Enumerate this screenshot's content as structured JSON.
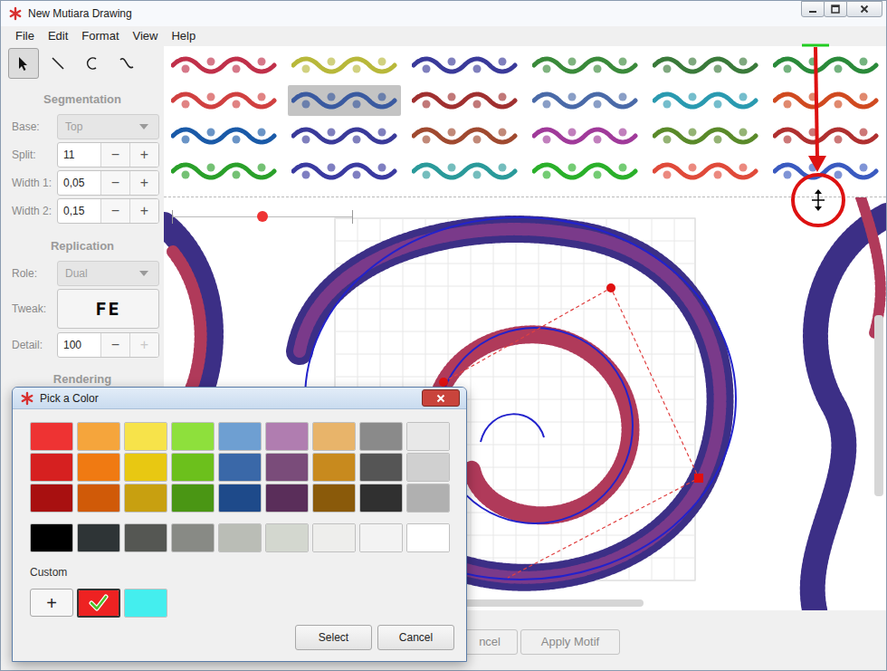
{
  "window": {
    "title": "New Mutiara Drawing"
  },
  "menu": [
    {
      "label": "File"
    },
    {
      "label": "Edit"
    },
    {
      "label": "Format"
    },
    {
      "label": "View"
    },
    {
      "label": "Help"
    }
  ],
  "tools": [
    {
      "kind": "pointer",
      "selected": true
    },
    {
      "kind": "line",
      "selected": false
    },
    {
      "kind": "arc",
      "selected": false
    },
    {
      "kind": "curve",
      "selected": false
    }
  ],
  "sections": [
    {
      "heading": "Segmentation",
      "fields": [
        {
          "label": "Base:",
          "kind": "select",
          "value": "Top",
          "disabled": true
        },
        {
          "label": "Split:",
          "kind": "spin",
          "value": "11",
          "decrement": {
            "label": "−",
            "disabled": false
          },
          "increment": {
            "label": "+",
            "disabled": false
          }
        },
        {
          "label": "Width 1:",
          "kind": "spin",
          "value": "0,05",
          "decrement": {
            "label": "−",
            "disabled": false
          },
          "increment": {
            "label": "+",
            "disabled": false
          }
        },
        {
          "label": "Width 2:",
          "kind": "spin",
          "value": "0,15",
          "decrement": {
            "label": "−",
            "disabled": false
          },
          "increment": {
            "label": "+",
            "disabled": false
          }
        }
      ]
    },
    {
      "heading": "Replication",
      "fields": [
        {
          "label": "Role:",
          "kind": "select",
          "value": "Dual",
          "disabled": true
        },
        {
          "label": "Tweak:",
          "kind": "glyph",
          "value": "FE"
        },
        {
          "label": "Detail:",
          "kind": "spin",
          "value": "100",
          "decrement": {
            "label": "−",
            "disabled": false
          },
          "increment": {
            "label": "+",
            "disabled": true
          }
        }
      ]
    },
    {
      "heading": "Rendering",
      "fields": []
    }
  ],
  "gallery": {
    "motifs": [
      {
        "color": "#c0304a",
        "selected": false
      },
      {
        "color": "#b8b83a",
        "selected": false
      },
      {
        "color": "#3a3a9a",
        "selected": false
      },
      {
        "color": "#3a8a3a",
        "selected": false
      },
      {
        "color": "#3a7a3a",
        "selected": false
      },
      {
        "color": "#2a8a3a",
        "selected": false
      },
      {
        "color": "#d04040",
        "selected": false
      },
      {
        "color": "#3a5aa0",
        "selected": true
      },
      {
        "color": "#a03030",
        "selected": false
      },
      {
        "color": "#4a6aa8",
        "selected": false
      },
      {
        "color": "#2a9ab0",
        "selected": false
      },
      {
        "color": "#d04a20",
        "selected": false
      },
      {
        "color": "#1a5aa8",
        "selected": false
      },
      {
        "color": "#3a3a9a",
        "selected": false
      },
      {
        "color": "#a04a30",
        "selected": false
      },
      {
        "color": "#a03a9a",
        "selected": false
      },
      {
        "color": "#5a8a2a",
        "selected": false
      },
      {
        "color": "#b03030",
        "selected": false
      },
      {
        "color": "#2aa02a",
        "selected": false
      },
      {
        "color": "#3a3aa0",
        "selected": false
      },
      {
        "color": "#2a9a9a",
        "selected": false
      },
      {
        "color": "#2ab02a",
        "selected": false
      },
      {
        "color": "#e04a3a",
        "selected": false
      },
      {
        "color": "#3a5ac0",
        "selected": false
      },
      {
        "color": "#2a9a2a",
        "selected": false
      },
      {
        "color": "#6aa0d0",
        "selected": false
      },
      {
        "color": "#3a9ab0",
        "selected": false
      },
      {
        "color": "#e0a020",
        "selected": false
      },
      {
        "color": "#e06a20",
        "selected": false
      },
      {
        "color": "#3a8a3a",
        "selected": false
      }
    ]
  },
  "canvas": {
    "ruler": {
      "level": 0.5
    }
  },
  "actions": [
    {
      "label": "ncel",
      "disabled": true
    },
    {
      "label": "Apply Motif",
      "disabled": true
    }
  ],
  "color_dialog": {
    "title": "Pick a Color",
    "palette": [
      [
        {
          "color": "#ee3333",
          "selected": false
        },
        {
          "color": "#f5a53c",
          "selected": false
        },
        {
          "color": "#f7e34a",
          "selected": false
        },
        {
          "color": "#8ee03c",
          "selected": false
        },
        {
          "color": "#6e9fd2",
          "selected": false
        },
        {
          "color": "#b07db0",
          "selected": false
        },
        {
          "color": "#e8b46a",
          "selected": false
        },
        {
          "color": "#8a8a8a",
          "selected": false
        },
        {
          "color": "#e8e8e8",
          "selected": false
        }
      ],
      [
        {
          "color": "#d62020",
          "selected": false
        },
        {
          "color": "#f07a12",
          "selected": false
        },
        {
          "color": "#e8c812",
          "selected": false
        },
        {
          "color": "#6cc01c",
          "selected": false
        },
        {
          "color": "#3a68a8",
          "selected": false
        },
        {
          "color": "#7a4c7a",
          "selected": false
        },
        {
          "color": "#c88a1e",
          "selected": false
        },
        {
          "color": "#555555",
          "selected": false
        },
        {
          "color": "#d0d0d0",
          "selected": false
        }
      ],
      [
        {
          "color": "#a81010",
          "selected": false
        },
        {
          "color": "#d05a08",
          "selected": false
        },
        {
          "color": "#c8a010",
          "selected": false
        },
        {
          "color": "#4a9614",
          "selected": false
        },
        {
          "color": "#1e4a8a",
          "selected": false
        },
        {
          "color": "#5a2e5a",
          "selected": false
        },
        {
          "color": "#8a5a0a",
          "selected": false
        },
        {
          "color": "#303030",
          "selected": false
        },
        {
          "color": "#b0b0b0",
          "selected": false
        }
      ]
    ],
    "grays": [
      {
        "color": "#000000",
        "selected": false
      },
      {
        "color": "#2e3436",
        "selected": false
      },
      {
        "color": "#555753",
        "selected": false
      },
      {
        "color": "#888a85",
        "selected": false
      },
      {
        "color": "#babdb6",
        "selected": false
      },
      {
        "color": "#d3d7cf",
        "selected": false
      },
      {
        "color": "#eeeeec",
        "selected": false
      },
      {
        "color": "#f3f3f3",
        "selected": false
      },
      {
        "color": "#ffffff",
        "selected": false
      }
    ],
    "custom_label": "Custom",
    "custom": [
      {
        "kind": "add",
        "label": "+"
      },
      {
        "kind": "swatch",
        "color": "#ee2222",
        "selected": true
      },
      {
        "kind": "swatch",
        "color": "#44eeee",
        "selected": false
      }
    ],
    "buttons": [
      {
        "label": "Select"
      },
      {
        "label": "Cancel"
      }
    ]
  }
}
